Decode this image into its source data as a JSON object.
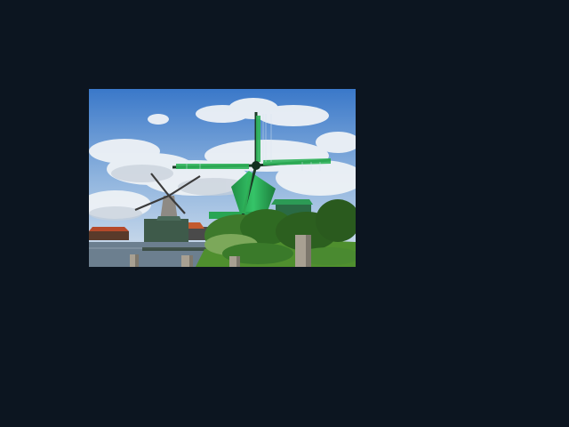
{
  "viewer": {
    "background_color": "#0c1520"
  },
  "image": {
    "subject_icon": "windmill-photo",
    "colors": {
      "sky": "#3f7fcf",
      "cloud": "#eef2f6",
      "windmill_green": "#2fb45a",
      "water": "#6c7f8f",
      "foliage": "#3e7a2c",
      "roof_red": "#b5492a"
    }
  }
}
